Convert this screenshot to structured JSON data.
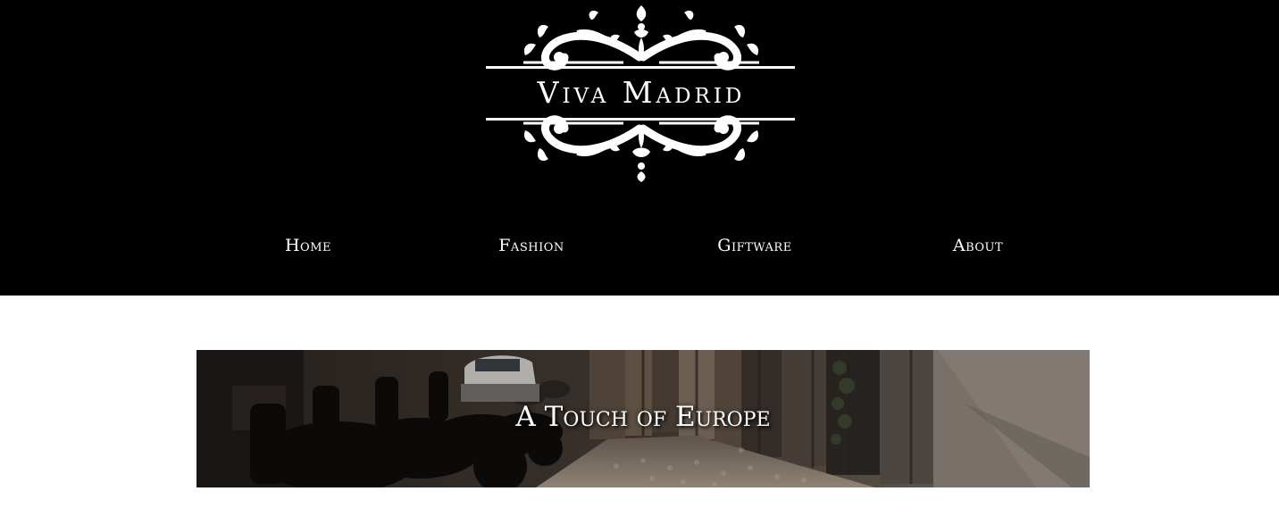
{
  "site": {
    "logo_text": "Viva Madrid",
    "logo_icon": "ornamental-scroll-logo"
  },
  "nav": {
    "items": [
      {
        "label": "Home"
      },
      {
        "label": "Fashion"
      },
      {
        "label": "Giftware"
      },
      {
        "label": "About"
      }
    ]
  },
  "banner": {
    "title": "A Touch of Europe"
  },
  "colors": {
    "header_bg": "#000000",
    "page_bg": "#ffffff",
    "text_light": "#ffffff"
  }
}
